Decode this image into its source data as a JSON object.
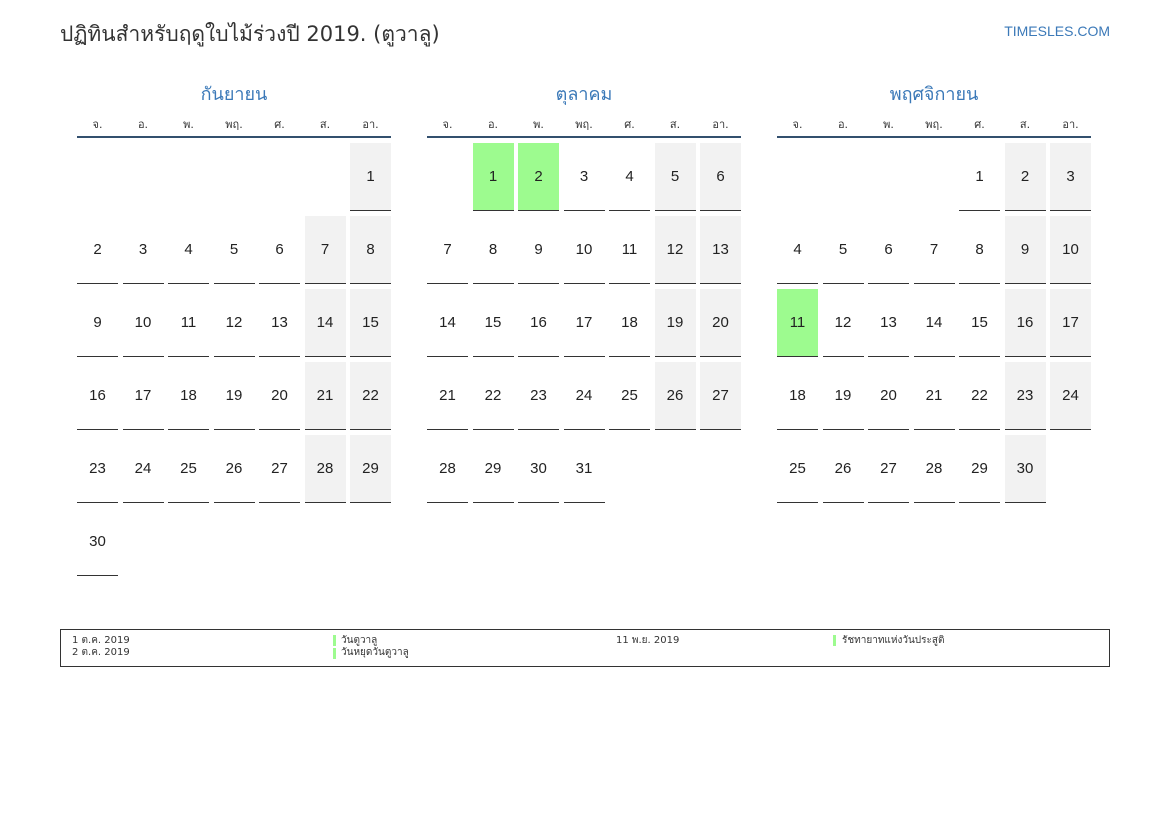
{
  "header": {
    "title": "ปฏิทินสำหรับฤดูใบไม้ร่วงปี 2019. (ตูวาลู)",
    "brand": "TIMESLES.COM"
  },
  "colors": {
    "accent": "#3b79b8",
    "holiday": "#9dfb8f",
    "weekend": "#f2f2f2",
    "rule": "#33506e"
  },
  "weekdays": [
    "จ.",
    "อ.",
    "พ.",
    "พฤ.",
    "ศ.",
    "ส.",
    "อา."
  ],
  "months": [
    {
      "name": "กันยายน",
      "offset": 6,
      "days": 30,
      "holidays": []
    },
    {
      "name": "ตุลาคม",
      "offset": 1,
      "days": 31,
      "holidays": [
        1,
        2
      ]
    },
    {
      "name": "พฤศจิกายน",
      "offset": 4,
      "days": 30,
      "holidays": [
        11
      ]
    }
  ],
  "legend": {
    "left": [
      {
        "date": "1 ต.ค. 2019",
        "name": "วันตูวาลู"
      },
      {
        "date": "2 ต.ค. 2019",
        "name": "วันหยุดวันตูวาลู"
      }
    ],
    "right": [
      {
        "date": "11 พ.ย. 2019",
        "name": "รัชทายาทแห่งวันประสูติ"
      }
    ]
  }
}
